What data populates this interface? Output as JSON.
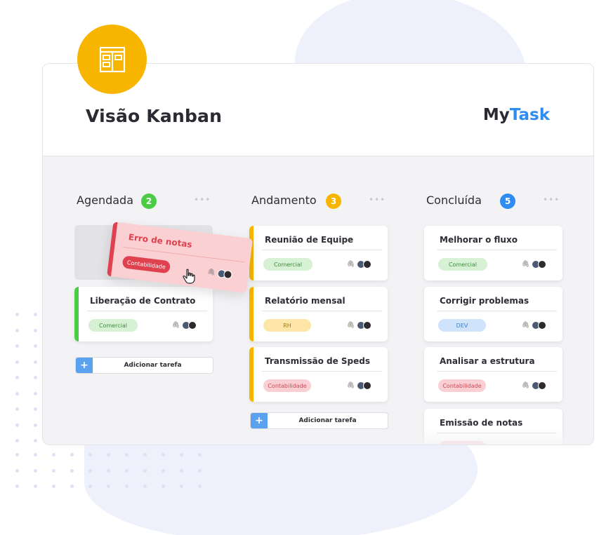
{
  "header": {
    "title": "Visão Kanban",
    "brand_part1": "My",
    "brand_part2": "Task",
    "icon": "kanban-board-icon"
  },
  "colors": {
    "icon_bg": "#f7b500",
    "brand_blue": "#2f8cf0",
    "green": "#4ccb45",
    "yellow": "#f7b500",
    "blue": "#2f8cf0",
    "red": "#e0414f"
  },
  "columns": [
    {
      "title": "Agendada",
      "count": "2",
      "more": "•••",
      "tasks": [
        {
          "title": "Liberação de Contrato",
          "tag": "Comercial"
        }
      ],
      "add_label": "Adicionar tarefa"
    },
    {
      "title": "Andamento",
      "count": "3",
      "more": "•••",
      "tasks": [
        {
          "title": "Reunião de Equipe",
          "tag": "Comercial"
        },
        {
          "title": "Relatório mensal",
          "tag": "RH"
        },
        {
          "title": "Transmissão de Speds",
          "tag": "Contabilidade"
        }
      ],
      "add_label": "Adicionar tarefa"
    },
    {
      "title": "Concluída",
      "count": "5",
      "more": "•••",
      "tasks": [
        {
          "title": "Melhorar o fluxo",
          "tag": "Comercial"
        },
        {
          "title": "Corrigir problemas",
          "tag": "DEV"
        },
        {
          "title": "Analisar a estrutura",
          "tag": "Contabilidade"
        },
        {
          "title": "Emissão de notas",
          "tag": ""
        }
      ]
    }
  ],
  "dragging": {
    "title": "Erro de notas",
    "tag": "Contabilidade"
  },
  "plus": "+",
  "clip": "🖇"
}
